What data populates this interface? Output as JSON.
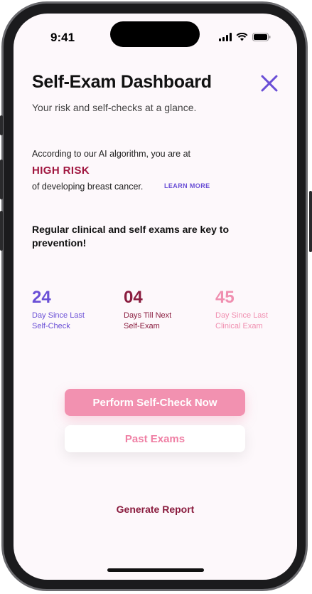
{
  "status_bar": {
    "time": "9:41",
    "icons": [
      "signal-icon",
      "wifi-icon",
      "battery-icon"
    ]
  },
  "header": {
    "title": "Self-Exam Dashboard",
    "subtitle": "Your risk and self-checks at a glance.",
    "close_icon": "close-icon"
  },
  "risk": {
    "intro": "According to our AI algorithm, you are at",
    "level": "HIGH RISK",
    "outro": "of developing breast cancer.",
    "learn_more": "LEARN MORE"
  },
  "key_message": "Regular clinical and self exams are key to prevention!",
  "stats": [
    {
      "value": "24",
      "label_line1": "Day Since Last",
      "label_line2": "Self-Check",
      "color": "#6a4fd6"
    },
    {
      "value": "04",
      "label_line1": "Days Till Next",
      "label_line2": "Self-Exam",
      "color": "#8a1d3f"
    },
    {
      "value": "45",
      "label_line1": "Day Since Last",
      "label_line2": "Clinical Exam",
      "color": "#f08fb0"
    }
  ],
  "actions": {
    "primary": "Perform Self-Check Now",
    "secondary": "Past Exams",
    "report": "Generate Report"
  },
  "colors": {
    "accent_purple": "#6a4fd6",
    "risk_red": "#a0163f",
    "pink": "#f291b0",
    "maroon": "#8a1d3f"
  }
}
